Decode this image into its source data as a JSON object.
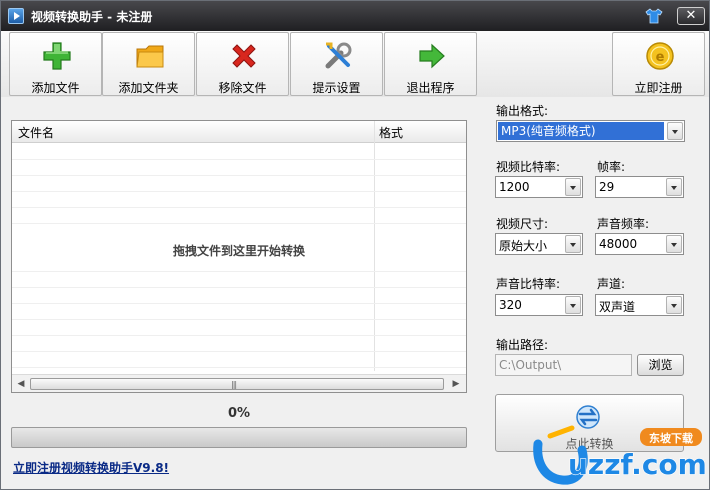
{
  "window": {
    "title": "视频转换助手 - 未注册",
    "close_label": "✕"
  },
  "toolbar": {
    "add_file": "添加文件",
    "add_folder": "添加文件夹",
    "remove_file": "移除文件",
    "prompt_settings": "提示设置",
    "exit": "退出程序",
    "register": "立即注册"
  },
  "file_list": {
    "columns": [
      "文件名",
      "格式"
    ],
    "hint": "拖拽文件到这里开始转换",
    "scroll_grip": "|||"
  },
  "progress": {
    "percent_label": "0%",
    "value": 0
  },
  "register_link": "立即注册视频转换助手V9.8!",
  "settings": {
    "output_format_label": "输出格式:",
    "output_format_value": "MP3(纯音频格式)",
    "video_bitrate_label": "视频比特率:",
    "video_bitrate_value": "1200",
    "frame_rate_label": "帧率:",
    "frame_rate_value": "29",
    "video_size_label": "视频尺寸:",
    "video_size_value": "原始大小",
    "audio_freq_label": "声音频率:",
    "audio_freq_value": "48000",
    "audio_bitrate_label": "声音比特率:",
    "audio_bitrate_value": "320",
    "channel_label": "声道:",
    "channel_value": "双声道",
    "output_path_label": "输出路径:",
    "output_path_value": "C:\\Output\\",
    "browse_label": "浏览"
  },
  "start_button": {
    "label": "点此转换"
  },
  "watermark": {
    "brand": "uzzf.com",
    "tag": "东坡下载"
  },
  "colors": {
    "titlebar": "#2e2e31",
    "selection": "#3170d6",
    "link": "#0a2a86"
  }
}
